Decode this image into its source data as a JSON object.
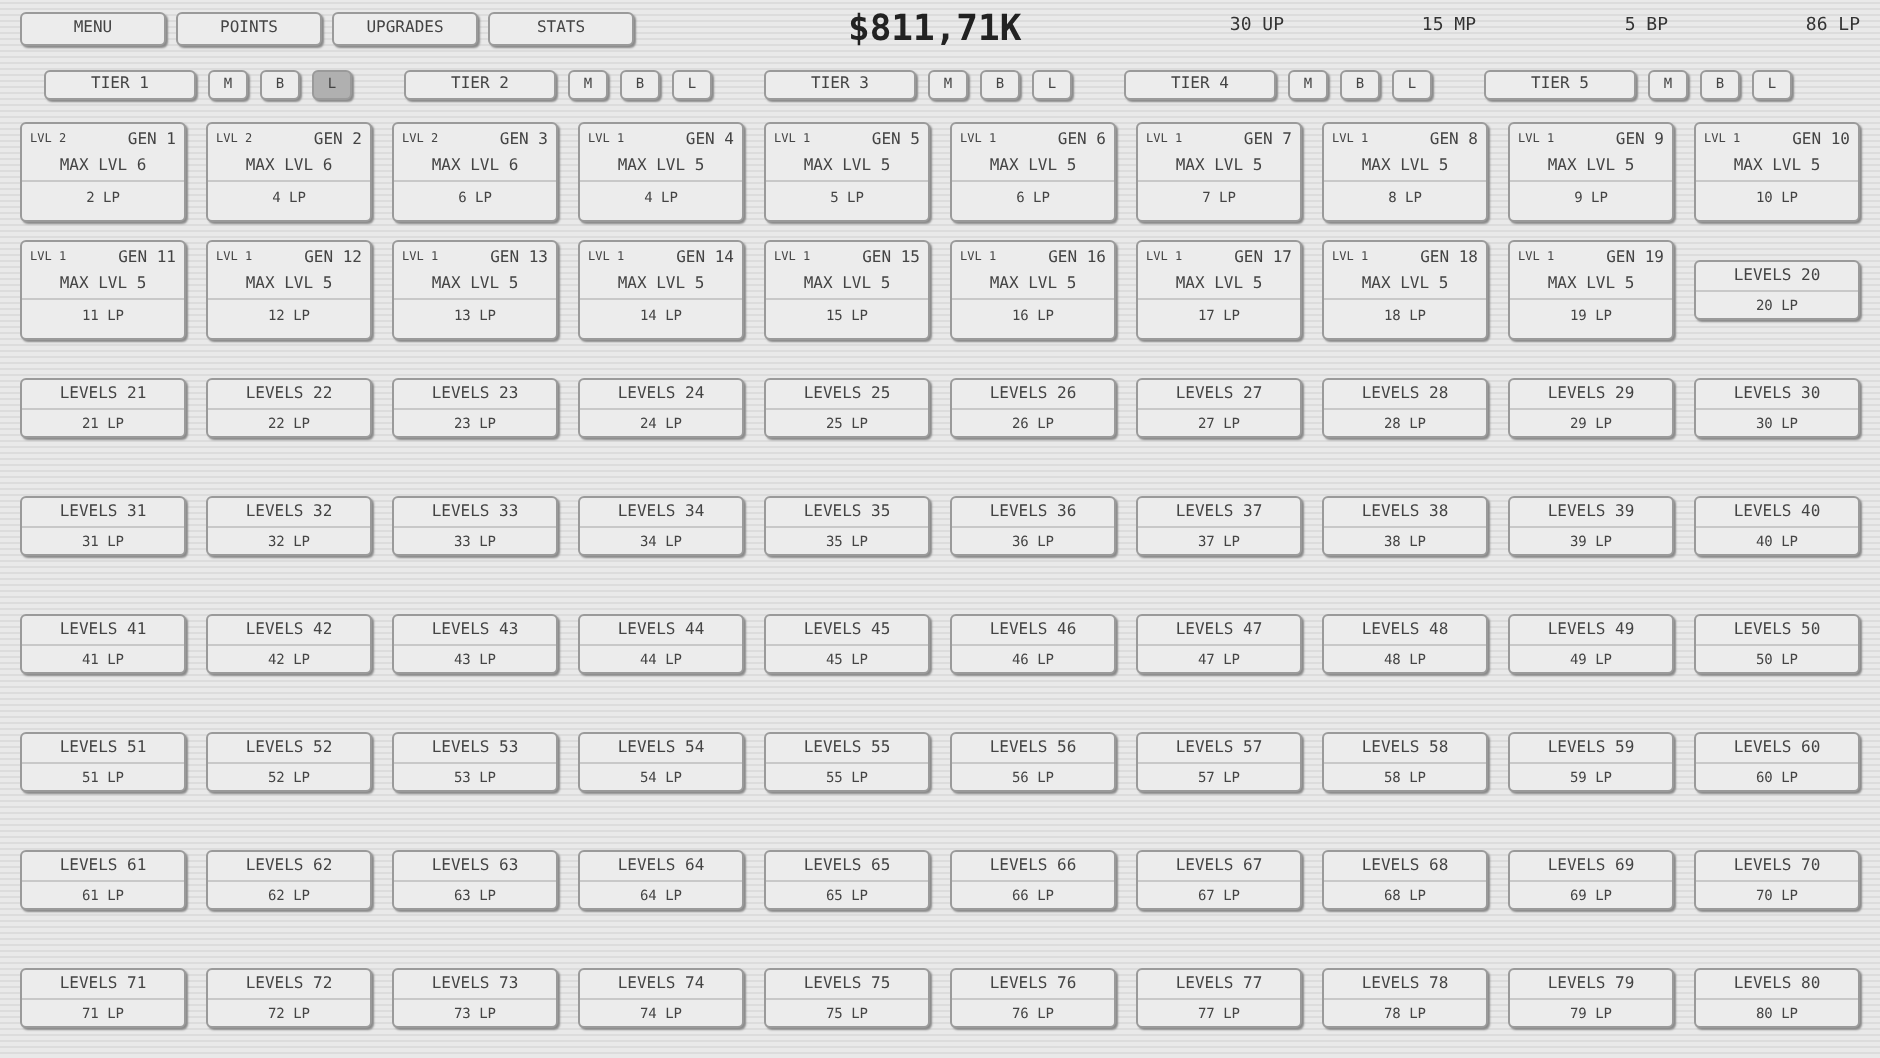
{
  "nav": [
    {
      "label": "MENU"
    },
    {
      "label": "POINTS"
    },
    {
      "label": "UPGRADES"
    },
    {
      "label": "STATS"
    }
  ],
  "money": "$811,71K",
  "stats": [
    "30 UP",
    "15 MP",
    "5 BP",
    "86 LP"
  ],
  "tiers": [
    {
      "label": "TIER 1",
      "buttons": [
        {
          "label": "M",
          "selected": false
        },
        {
          "label": "B",
          "selected": false
        },
        {
          "label": "L",
          "selected": true
        }
      ]
    },
    {
      "label": "TIER 2",
      "buttons": [
        {
          "label": "M",
          "selected": false
        },
        {
          "label": "B",
          "selected": false
        },
        {
          "label": "L",
          "selected": false
        }
      ]
    },
    {
      "label": "TIER 3",
      "buttons": [
        {
          "label": "M",
          "selected": false
        },
        {
          "label": "B",
          "selected": false
        },
        {
          "label": "L",
          "selected": false
        }
      ]
    },
    {
      "label": "TIER 4",
      "buttons": [
        {
          "label": "M",
          "selected": false
        },
        {
          "label": "B",
          "selected": false
        },
        {
          "label": "L",
          "selected": false
        }
      ]
    },
    {
      "label": "TIER 5",
      "buttons": [
        {
          "label": "M",
          "selected": false
        },
        {
          "label": "B",
          "selected": false
        },
        {
          "label": "L",
          "selected": false
        }
      ]
    }
  ],
  "tiles": [
    {
      "kind": "gen",
      "lvl": "LVL 2",
      "name": "GEN 1",
      "max": "MAX LVL 6",
      "cost": "2 LP"
    },
    {
      "kind": "gen",
      "lvl": "LVL 2",
      "name": "GEN 2",
      "max": "MAX LVL 6",
      "cost": "4 LP"
    },
    {
      "kind": "gen",
      "lvl": "LVL 2",
      "name": "GEN 3",
      "max": "MAX LVL 6",
      "cost": "6 LP"
    },
    {
      "kind": "gen",
      "lvl": "LVL 1",
      "name": "GEN 4",
      "max": "MAX LVL 5",
      "cost": "4 LP"
    },
    {
      "kind": "gen",
      "lvl": "LVL 1",
      "name": "GEN 5",
      "max": "MAX LVL 5",
      "cost": "5 LP"
    },
    {
      "kind": "gen",
      "lvl": "LVL 1",
      "name": "GEN 6",
      "max": "MAX LVL 5",
      "cost": "6 LP"
    },
    {
      "kind": "gen",
      "lvl": "LVL 1",
      "name": "GEN 7",
      "max": "MAX LVL 5",
      "cost": "7 LP"
    },
    {
      "kind": "gen",
      "lvl": "LVL 1",
      "name": "GEN 8",
      "max": "MAX LVL 5",
      "cost": "8 LP"
    },
    {
      "kind": "gen",
      "lvl": "LVL 1",
      "name": "GEN 9",
      "max": "MAX LVL 5",
      "cost": "9 LP"
    },
    {
      "kind": "gen",
      "lvl": "LVL 1",
      "name": "GEN 10",
      "max": "MAX LVL 5",
      "cost": "10 LP"
    },
    {
      "kind": "gen",
      "lvl": "LVL 1",
      "name": "GEN 11",
      "max": "MAX LVL 5",
      "cost": "11 LP"
    },
    {
      "kind": "gen",
      "lvl": "LVL 1",
      "name": "GEN 12",
      "max": "MAX LVL 5",
      "cost": "12 LP"
    },
    {
      "kind": "gen",
      "lvl": "LVL 1",
      "name": "GEN 13",
      "max": "MAX LVL 5",
      "cost": "13 LP"
    },
    {
      "kind": "gen",
      "lvl": "LVL 1",
      "name": "GEN 14",
      "max": "MAX LVL 5",
      "cost": "14 LP"
    },
    {
      "kind": "gen",
      "lvl": "LVL 1",
      "name": "GEN 15",
      "max": "MAX LVL 5",
      "cost": "15 LP"
    },
    {
      "kind": "gen",
      "lvl": "LVL 1",
      "name": "GEN 16",
      "max": "MAX LVL 5",
      "cost": "16 LP"
    },
    {
      "kind": "gen",
      "lvl": "LVL 1",
      "name": "GEN 17",
      "max": "MAX LVL 5",
      "cost": "17 LP"
    },
    {
      "kind": "gen",
      "lvl": "LVL 1",
      "name": "GEN 18",
      "max": "MAX LVL 5",
      "cost": "18 LP"
    },
    {
      "kind": "gen",
      "lvl": "LVL 1",
      "name": "GEN 19",
      "max": "MAX LVL 5",
      "cost": "19 LP"
    },
    {
      "kind": "levels",
      "name": "LEVELS 20",
      "cost": "20 LP"
    },
    {
      "kind": "levels",
      "name": "LEVELS 21",
      "cost": "21 LP"
    },
    {
      "kind": "levels",
      "name": "LEVELS 22",
      "cost": "22 LP"
    },
    {
      "kind": "levels",
      "name": "LEVELS 23",
      "cost": "23 LP"
    },
    {
      "kind": "levels",
      "name": "LEVELS 24",
      "cost": "24 LP"
    },
    {
      "kind": "levels",
      "name": "LEVELS 25",
      "cost": "25 LP"
    },
    {
      "kind": "levels",
      "name": "LEVELS 26",
      "cost": "26 LP"
    },
    {
      "kind": "levels",
      "name": "LEVELS 27",
      "cost": "27 LP"
    },
    {
      "kind": "levels",
      "name": "LEVELS 28",
      "cost": "28 LP"
    },
    {
      "kind": "levels",
      "name": "LEVELS 29",
      "cost": "29 LP"
    },
    {
      "kind": "levels",
      "name": "LEVELS 30",
      "cost": "30 LP"
    },
    {
      "kind": "levels",
      "name": "LEVELS 31",
      "cost": "31 LP"
    },
    {
      "kind": "levels",
      "name": "LEVELS 32",
      "cost": "32 LP"
    },
    {
      "kind": "levels",
      "name": "LEVELS 33",
      "cost": "33 LP"
    },
    {
      "kind": "levels",
      "name": "LEVELS 34",
      "cost": "34 LP"
    },
    {
      "kind": "levels",
      "name": "LEVELS 35",
      "cost": "35 LP"
    },
    {
      "kind": "levels",
      "name": "LEVELS 36",
      "cost": "36 LP"
    },
    {
      "kind": "levels",
      "name": "LEVELS 37",
      "cost": "37 LP"
    },
    {
      "kind": "levels",
      "name": "LEVELS 38",
      "cost": "38 LP"
    },
    {
      "kind": "levels",
      "name": "LEVELS 39",
      "cost": "39 LP"
    },
    {
      "kind": "levels",
      "name": "LEVELS 40",
      "cost": "40 LP"
    },
    {
      "kind": "levels",
      "name": "LEVELS 41",
      "cost": "41 LP"
    },
    {
      "kind": "levels",
      "name": "LEVELS 42",
      "cost": "42 LP"
    },
    {
      "kind": "levels",
      "name": "LEVELS 43",
      "cost": "43 LP"
    },
    {
      "kind": "levels",
      "name": "LEVELS 44",
      "cost": "44 LP"
    },
    {
      "kind": "levels",
      "name": "LEVELS 45",
      "cost": "45 LP"
    },
    {
      "kind": "levels",
      "name": "LEVELS 46",
      "cost": "46 LP"
    },
    {
      "kind": "levels",
      "name": "LEVELS 47",
      "cost": "47 LP"
    },
    {
      "kind": "levels",
      "name": "LEVELS 48",
      "cost": "48 LP"
    },
    {
      "kind": "levels",
      "name": "LEVELS 49",
      "cost": "49 LP"
    },
    {
      "kind": "levels",
      "name": "LEVELS 50",
      "cost": "50 LP"
    },
    {
      "kind": "levels",
      "name": "LEVELS 51",
      "cost": "51 LP"
    },
    {
      "kind": "levels",
      "name": "LEVELS 52",
      "cost": "52 LP"
    },
    {
      "kind": "levels",
      "name": "LEVELS 53",
      "cost": "53 LP"
    },
    {
      "kind": "levels",
      "name": "LEVELS 54",
      "cost": "54 LP"
    },
    {
      "kind": "levels",
      "name": "LEVELS 55",
      "cost": "55 LP"
    },
    {
      "kind": "levels",
      "name": "LEVELS 56",
      "cost": "56 LP"
    },
    {
      "kind": "levels",
      "name": "LEVELS 57",
      "cost": "57 LP"
    },
    {
      "kind": "levels",
      "name": "LEVELS 58",
      "cost": "58 LP"
    },
    {
      "kind": "levels",
      "name": "LEVELS 59",
      "cost": "59 LP"
    },
    {
      "kind": "levels",
      "name": "LEVELS 60",
      "cost": "60 LP"
    },
    {
      "kind": "levels",
      "name": "LEVELS 61",
      "cost": "61 LP"
    },
    {
      "kind": "levels",
      "name": "LEVELS 62",
      "cost": "62 LP"
    },
    {
      "kind": "levels",
      "name": "LEVELS 63",
      "cost": "63 LP"
    },
    {
      "kind": "levels",
      "name": "LEVELS 64",
      "cost": "64 LP"
    },
    {
      "kind": "levels",
      "name": "LEVELS 65",
      "cost": "65 LP"
    },
    {
      "kind": "levels",
      "name": "LEVELS 66",
      "cost": "66 LP"
    },
    {
      "kind": "levels",
      "name": "LEVELS 67",
      "cost": "67 LP"
    },
    {
      "kind": "levels",
      "name": "LEVELS 68",
      "cost": "68 LP"
    },
    {
      "kind": "levels",
      "name": "LEVELS 69",
      "cost": "69 LP"
    },
    {
      "kind": "levels",
      "name": "LEVELS 70",
      "cost": "70 LP"
    },
    {
      "kind": "levels",
      "name": "LEVELS 71",
      "cost": "71 LP"
    },
    {
      "kind": "levels",
      "name": "LEVELS 72",
      "cost": "72 LP"
    },
    {
      "kind": "levels",
      "name": "LEVELS 73",
      "cost": "73 LP"
    },
    {
      "kind": "levels",
      "name": "LEVELS 74",
      "cost": "74 LP"
    },
    {
      "kind": "levels",
      "name": "LEVELS 75",
      "cost": "75 LP"
    },
    {
      "kind": "levels",
      "name": "LEVELS 76",
      "cost": "76 LP"
    },
    {
      "kind": "levels",
      "name": "LEVELS 77",
      "cost": "77 LP"
    },
    {
      "kind": "levels",
      "name": "LEVELS 78",
      "cost": "78 LP"
    },
    {
      "kind": "levels",
      "name": "LEVELS 79",
      "cost": "79 LP"
    },
    {
      "kind": "levels",
      "name": "LEVELS 80",
      "cost": "80 LP"
    }
  ]
}
